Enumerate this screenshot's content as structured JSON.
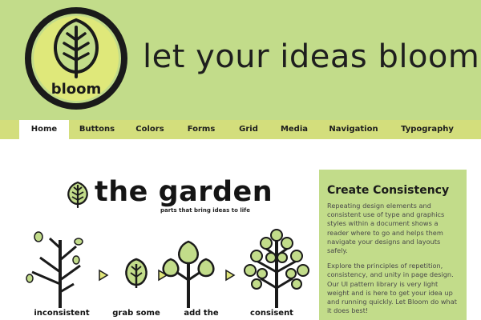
{
  "header": {
    "logo_text": "bloom",
    "tagline": "let your ideas bloom"
  },
  "nav": {
    "items": [
      {
        "label": "Home",
        "active": true
      },
      {
        "label": "Buttons",
        "active": false
      },
      {
        "label": "Colors",
        "active": false
      },
      {
        "label": "Forms",
        "active": false
      },
      {
        "label": "Grid",
        "active": false
      },
      {
        "label": "Media",
        "active": false
      },
      {
        "label": "Navigation",
        "active": false
      },
      {
        "label": "Typography",
        "active": false
      }
    ]
  },
  "garden": {
    "title": "the garden",
    "subtitle": "parts that bring ideas to life",
    "steps": [
      {
        "label": "inconsistent"
      },
      {
        "label": "grab some"
      },
      {
        "label": "add the"
      },
      {
        "label": "consisent"
      }
    ]
  },
  "sidebar": {
    "title": "Create Consistency",
    "paragraphs": [
      "Repeating design elements and consistent use of type and graphics styles within a document shows a reader where to go and helps them navigate your designs and layouts safely.",
      "Explore the principles of repetition, consistency, and unity in page design. Our UI pattern library is very light weight and is here to get your idea up and running quickly. Let Bloom do what it does best!"
    ]
  },
  "colors": {
    "header_bg": "#c2dc8a",
    "nav_bg": "#d3de7c",
    "leaf_fill": "#c2dc8a",
    "logo_inner": "#dfe87a",
    "arrow_fill": "#e0e67a",
    "ink": "#1a1a1a"
  },
  "icons": [
    "bloom-logo-icon",
    "leaf-icon",
    "arrow-right-icon",
    "tree-icon"
  ]
}
